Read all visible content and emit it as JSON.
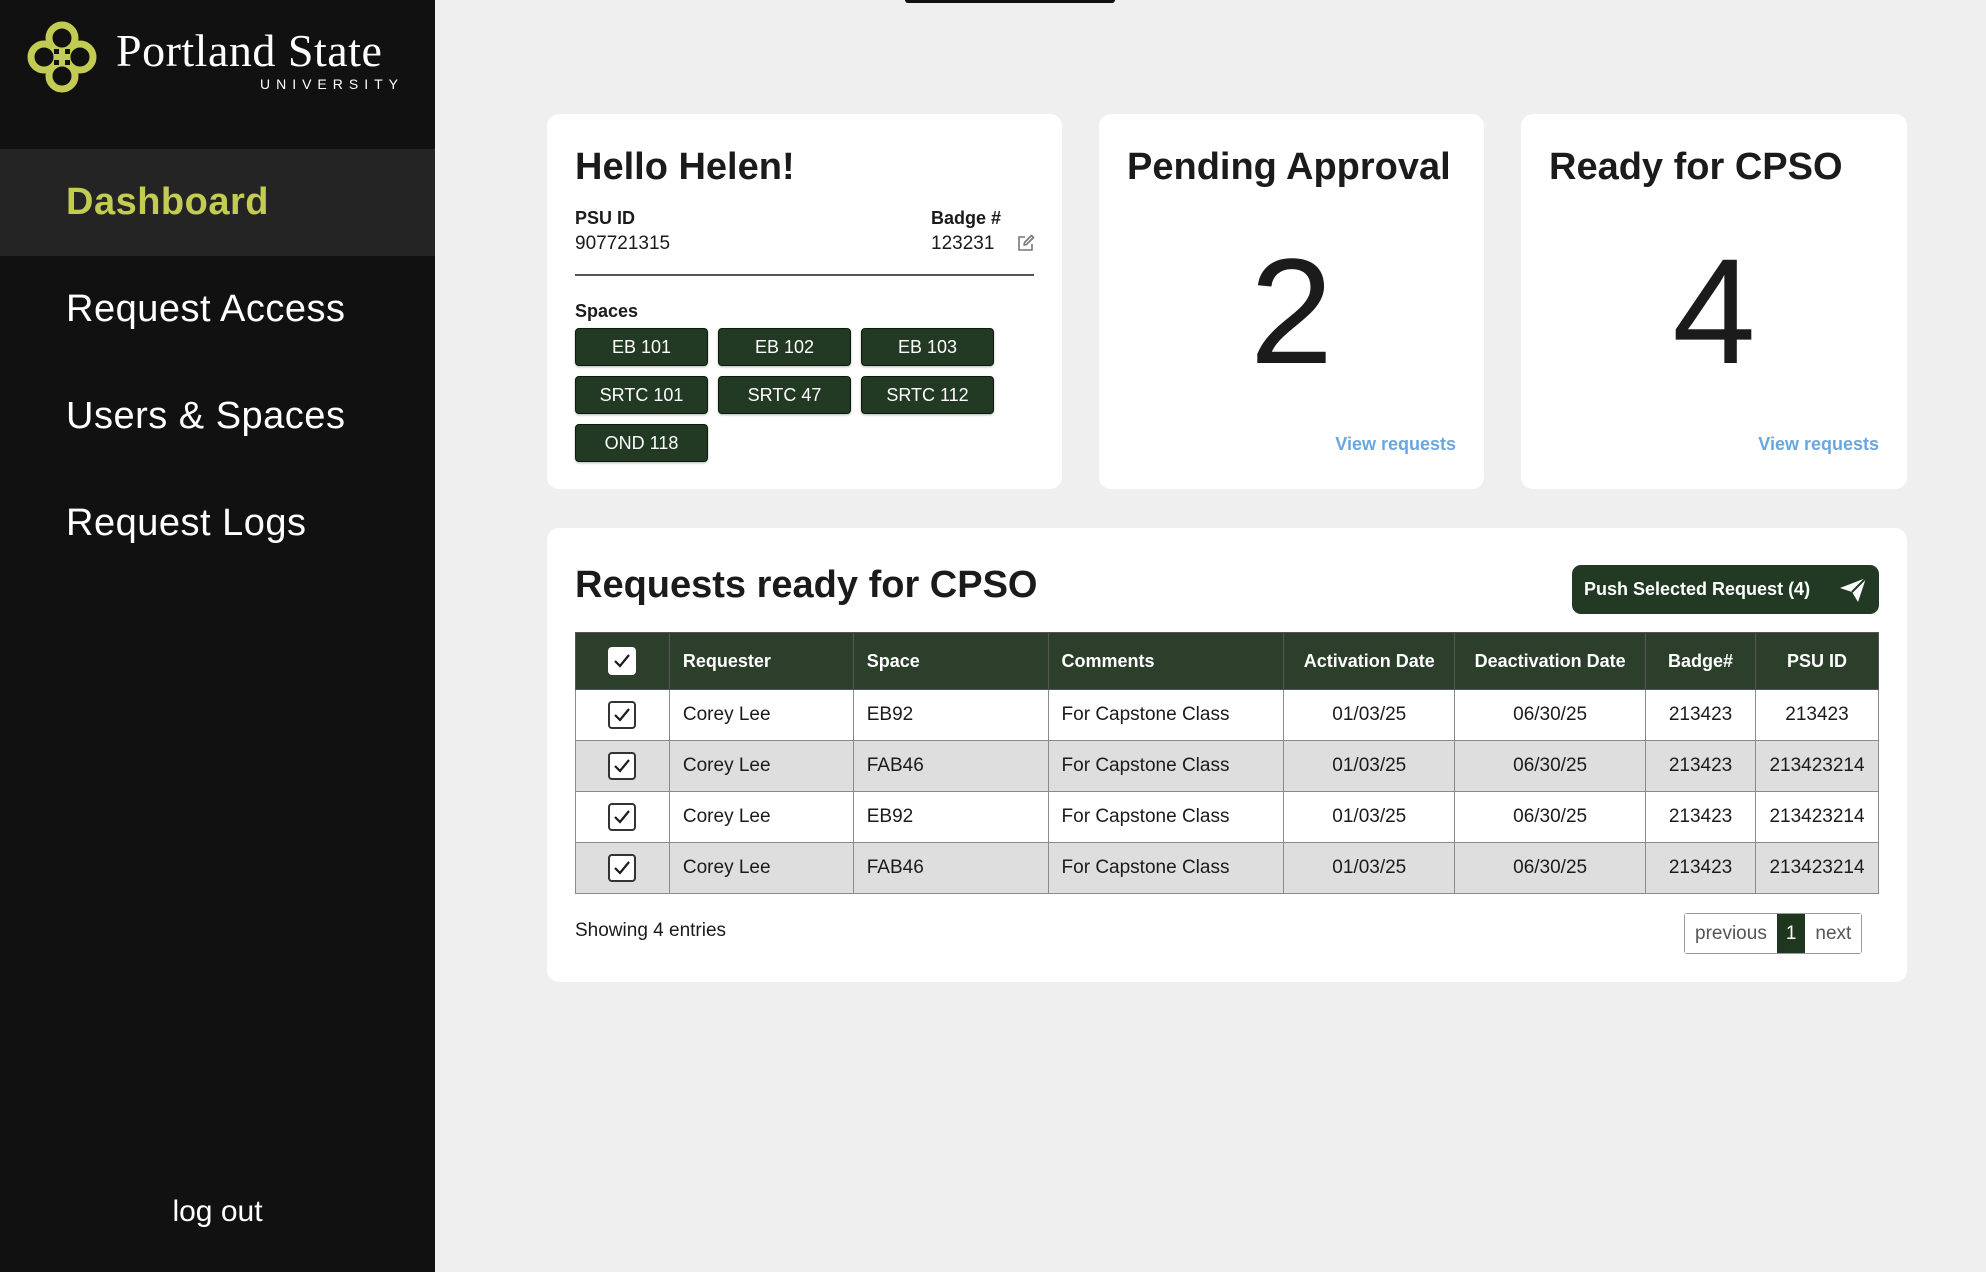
{
  "sidebar": {
    "logo": {
      "name": "Portland State",
      "sub": "UNIVERSITY"
    },
    "items": [
      {
        "label": "Dashboard",
        "active": true
      },
      {
        "label": "Request Access"
      },
      {
        "label": "Users & Spaces"
      },
      {
        "label": "Request Logs"
      }
    ],
    "logout": "log out"
  },
  "profile": {
    "greeting": "Hello Helen!",
    "psu_id_label": "PSU ID",
    "psu_id": "907721315",
    "badge_label": "Badge #",
    "badge": "123231",
    "spaces_label": "Spaces",
    "spaces": [
      "EB 101",
      "EB 102",
      "EB 103",
      "SRTC 101",
      "SRTC 47",
      "SRTC 112",
      "OND 118"
    ]
  },
  "pending": {
    "title": "Pending Approval",
    "count": "2",
    "link": "View requests"
  },
  "ready": {
    "title": "Ready for CPSO",
    "count": "4",
    "link": "View requests"
  },
  "requests": {
    "title": "Requests ready for CPSO",
    "push_label": "Push Selected Request (4)",
    "columns": [
      "Requester",
      "Space",
      "Comments",
      "Activation Date",
      "Deactivation Date",
      "Badge#",
      "PSU ID"
    ],
    "rows": [
      {
        "requester": "Corey Lee",
        "space": "EB92",
        "comments": "For Capstone Class",
        "activation": "01/03/25",
        "deactivation": "06/30/25",
        "badge": "213423",
        "psu_id": "213423",
        "checked": true
      },
      {
        "requester": "Corey Lee",
        "space": "FAB46",
        "comments": "For Capstone Class",
        "activation": "01/03/25",
        "deactivation": "06/30/25",
        "badge": "213423",
        "psu_id": "213423214",
        "checked": true
      },
      {
        "requester": "Corey Lee",
        "space": "EB92",
        "comments": "For Capstone Class",
        "activation": "01/03/25",
        "deactivation": "06/30/25",
        "badge": "213423",
        "psu_id": "213423214",
        "checked": true
      },
      {
        "requester": "Corey Lee",
        "space": "FAB46",
        "comments": "For Capstone Class",
        "activation": "01/03/25",
        "deactivation": "06/30/25",
        "badge": "213423",
        "psu_id": "213423214",
        "checked": true
      }
    ],
    "showing": "Showing 4 entries",
    "pager": {
      "previous": "previous",
      "current": "1",
      "next": "next"
    }
  },
  "colors": {
    "sidebar": "#111111",
    "accent": "#c3cc52",
    "brand_green": "#223a23",
    "link": "#6aa6e0"
  }
}
